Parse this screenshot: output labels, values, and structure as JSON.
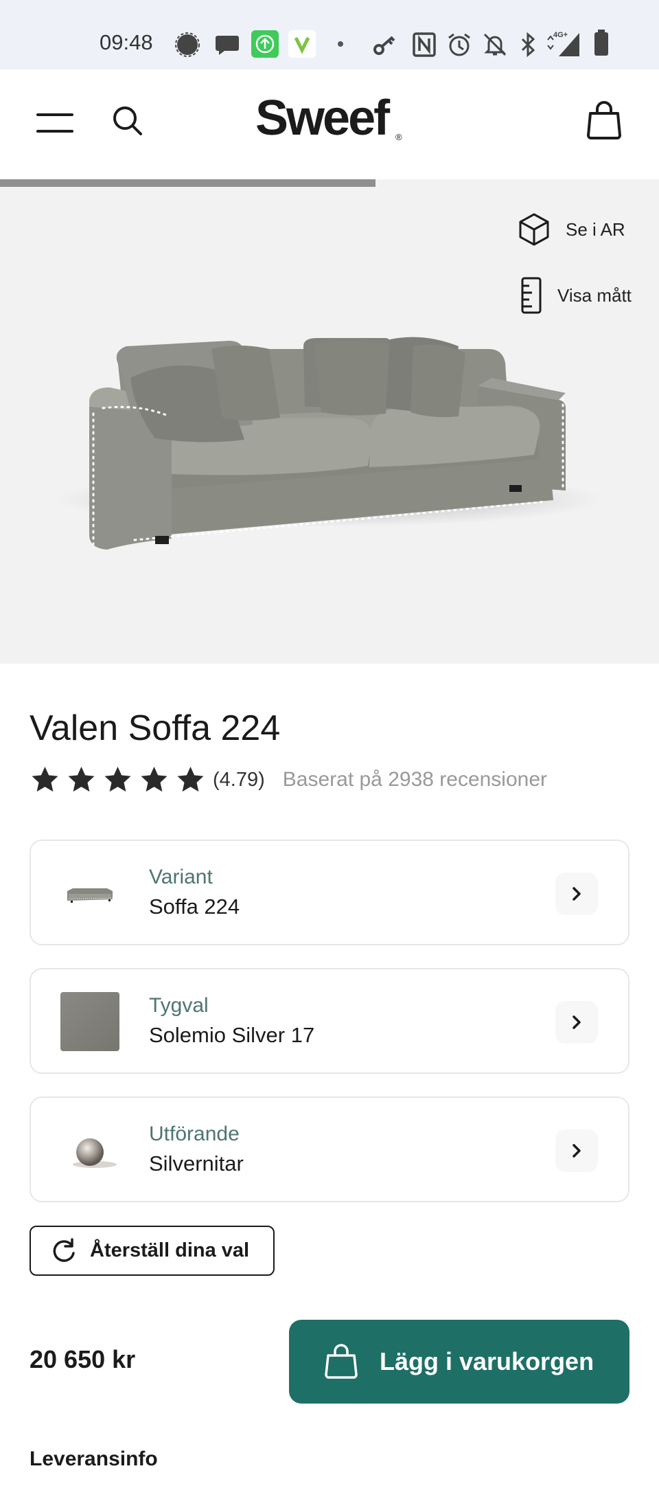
{
  "status_bar": {
    "time": "09:48",
    "icons": [
      "signal-messenger-icon",
      "chat-icon",
      "upload-icon",
      "v-app-icon",
      "dot-icon",
      "key-icon",
      "nfc-icon",
      "alarm-icon",
      "mute-icon",
      "bluetooth-icon",
      "network-4g-icon",
      "battery-icon"
    ]
  },
  "header": {
    "logo": "Sweef",
    "logo_mark": "®",
    "icons": [
      "menu-icon",
      "search-icon",
      "bag-icon"
    ]
  },
  "gallery": {
    "progress": 0.57,
    "ar_label": "Se i AR",
    "dimensions_label": "Visa mått"
  },
  "product": {
    "title": "Valen Soffa 224",
    "rating": "(4.79)",
    "stars": 5,
    "review_text": "Baserat på 2938 recensioner"
  },
  "options": [
    {
      "label": "Variant",
      "value": "Soffa 224"
    },
    {
      "label": "Tygval",
      "value": "Solemio Silver 17"
    },
    {
      "label": "Utförande",
      "value": "Silvernitar"
    }
  ],
  "reset_label": "Återställ dina val",
  "price": "20 650 kr",
  "add_to_cart_label": "Lägg i varukorgen",
  "delivery_heading": "Leveransinfo",
  "colors": {
    "accent": "#1e6f66",
    "option_label": "#4e7570",
    "hero_bg": "#f2f2f2",
    "status_bar_bg": "#eef2f8"
  }
}
